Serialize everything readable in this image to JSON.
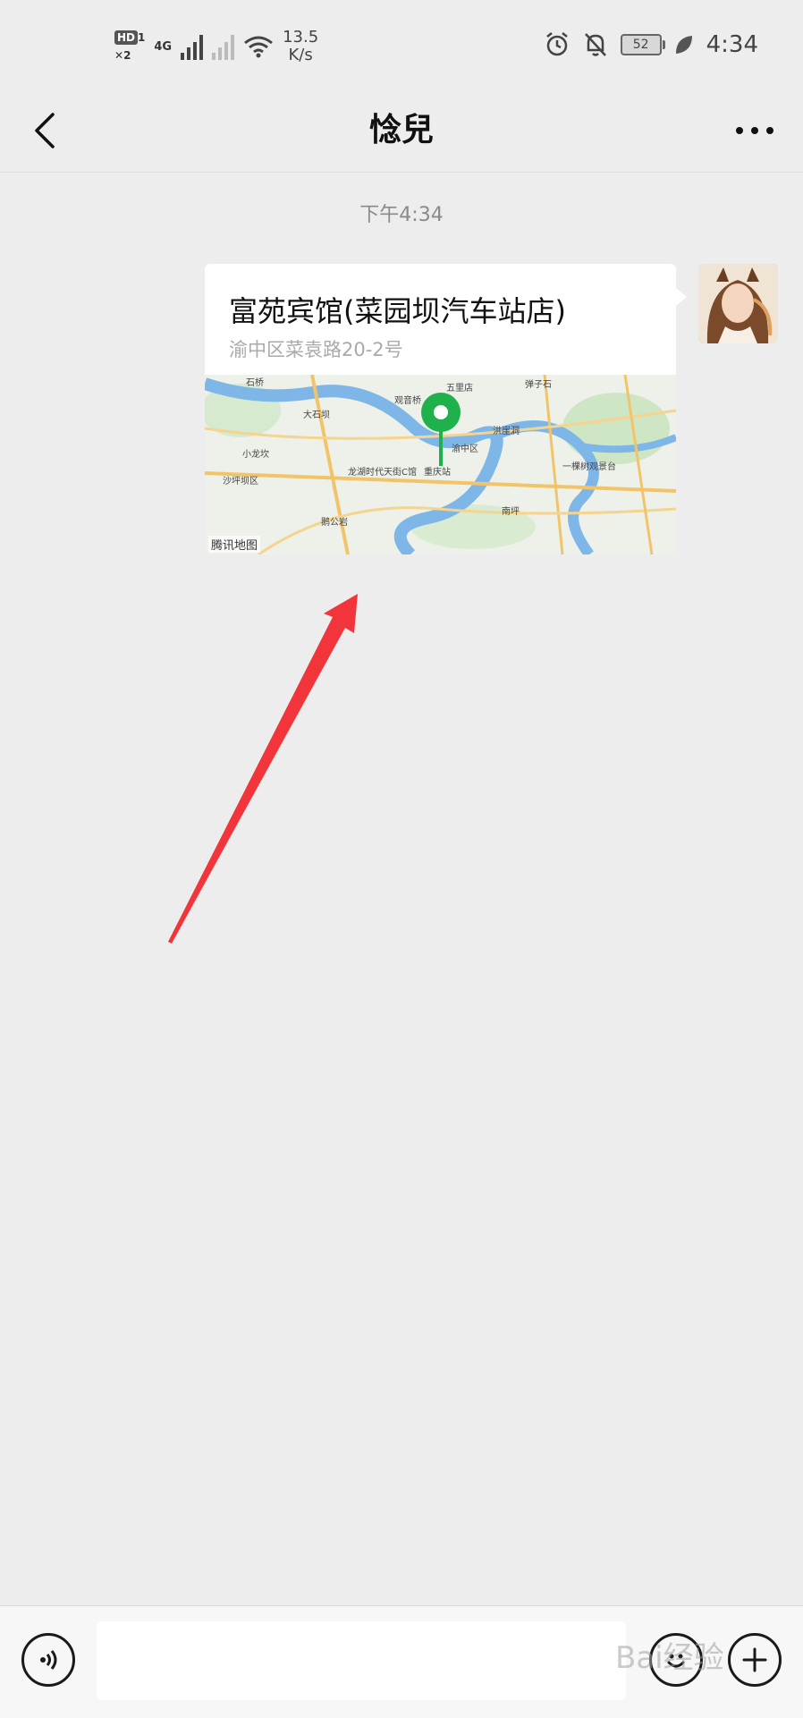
{
  "status_bar": {
    "hd_label": "HD",
    "sim1": "1",
    "sim2": "2",
    "network": "4G",
    "speed_value": "13.5",
    "speed_unit": "K/s",
    "battery": "52",
    "time": "4:34"
  },
  "header": {
    "title": "惗兒"
  },
  "chat": {
    "timestamp": "下午4:34",
    "message": {
      "type": "location",
      "place_name": "富苑宾馆(菜园坝汽车站店)",
      "address": "渝中区菜袁路20-2号",
      "map_credit": "腾讯地图",
      "map_labels": [
        "石桥",
        "大石坝",
        "龙湖时代天街C馆",
        "沙坪坝区",
        "小龙坎",
        "观音桥",
        "五里店",
        "渝中区",
        "洪崖洞",
        "重庆站",
        "南坪",
        "一棵树观景台",
        "弹子石",
        "鹅公岩"
      ],
      "pin_color": "#1fb24c"
    }
  },
  "input_bar": {
    "text_value": ""
  },
  "watermark": "Bai经验"
}
